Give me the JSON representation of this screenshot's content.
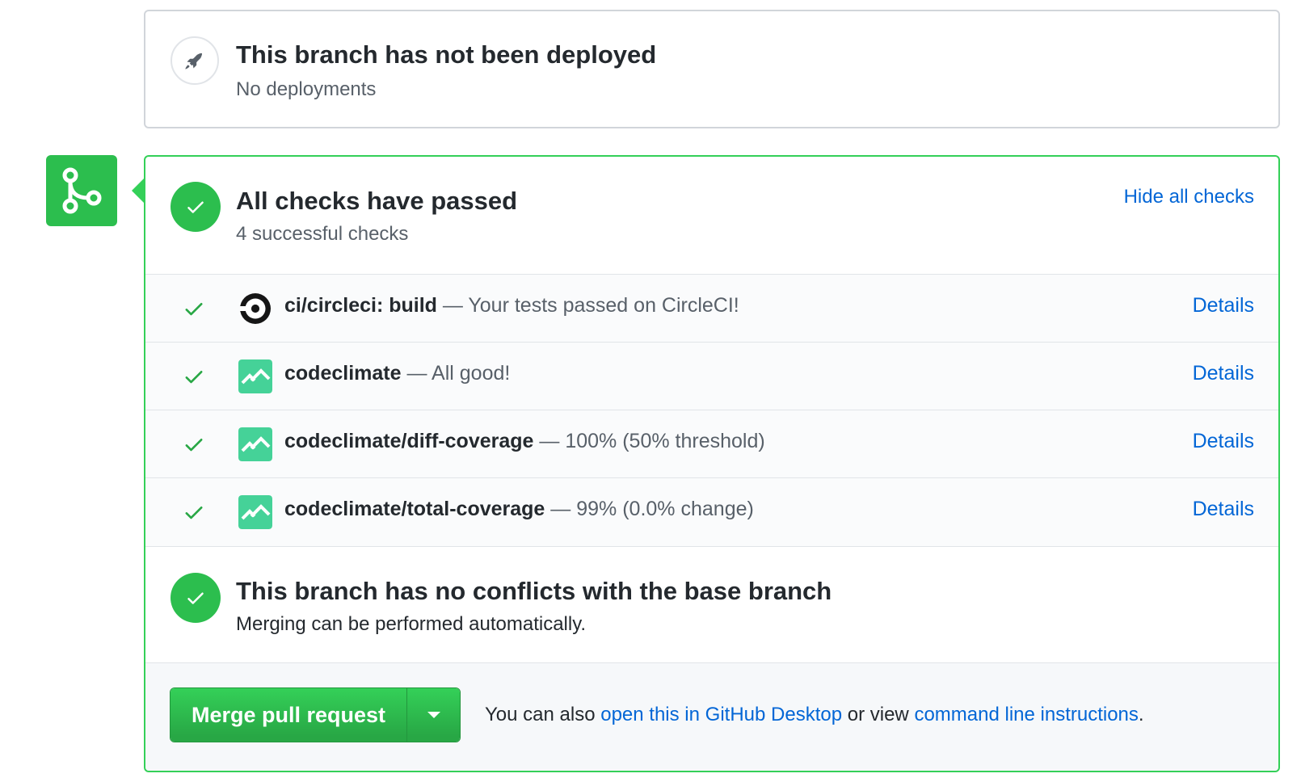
{
  "deployment": {
    "title": "This branch has not been deployed",
    "subtitle": "No deployments",
    "icon": "rocket-icon"
  },
  "checks": {
    "title": "All checks have passed",
    "subtitle": "4 successful checks",
    "toggle_label": "Hide all checks",
    "items": [
      {
        "name": "ci/circleci: build",
        "description": "— Your tests passed on CircleCI!",
        "details_label": "Details",
        "icon": "circleci-icon"
      },
      {
        "name": "codeclimate",
        "description": "— All good!",
        "details_label": "Details",
        "icon": "codeclimate-icon"
      },
      {
        "name": "codeclimate/diff-coverage",
        "description": "— 100% (50% threshold)",
        "details_label": "Details",
        "icon": "codeclimate-icon"
      },
      {
        "name": "codeclimate/total-coverage",
        "description": "— 99% (0.0% change)",
        "details_label": "Details",
        "icon": "codeclimate-icon"
      }
    ]
  },
  "conflicts": {
    "title": "This branch has no conflicts with the base branch",
    "subtitle": "Merging can be performed automatically."
  },
  "merge": {
    "button_label": "Merge pull request",
    "text_prefix": "You can also",
    "desktop_link": "open this in GitHub Desktop",
    "text_middle": "or view",
    "cli_link": "command line instructions",
    "text_suffix": "."
  },
  "colors": {
    "success_green": "#2cbe4e",
    "link_blue": "#0366d6",
    "codeclimate_green": "#45d298"
  }
}
